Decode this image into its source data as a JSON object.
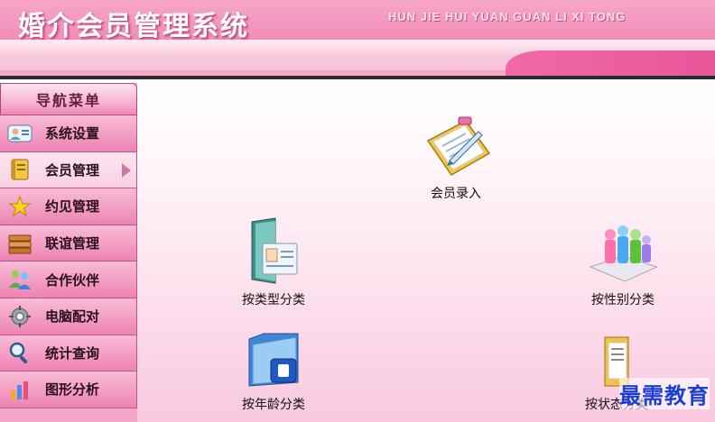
{
  "header": {
    "title": "婚介会员管理系统",
    "subtitle": "HUN JIE HUI YUAN GUAN LI XI TONG"
  },
  "sidebar": {
    "title": "导航菜单",
    "items": [
      {
        "label": "系统设置",
        "icon": "user-settings-icon"
      },
      {
        "label": "会员管理",
        "icon": "book-icon",
        "active": true
      },
      {
        "label": "约见管理",
        "icon": "star-icon"
      },
      {
        "label": "联谊管理",
        "icon": "stack-icon"
      },
      {
        "label": "合作伙伴",
        "icon": "people-icon"
      },
      {
        "label": "电脑配对",
        "icon": "gear-icon"
      },
      {
        "label": "统计查询",
        "icon": "magnifier-icon"
      },
      {
        "label": "图形分析",
        "icon": "bar-chart-icon"
      }
    ]
  },
  "main": {
    "tiles": [
      {
        "label": "会员录入",
        "icon": "clipboard-pen-icon"
      },
      {
        "label": "按类型分类",
        "icon": "contact-card-icon"
      },
      {
        "label": "按性别分类",
        "icon": "people-figures-icon"
      },
      {
        "label": "按年龄分类",
        "icon": "blue-folder-icon"
      },
      {
        "label": "按状态分类",
        "icon": "yellow-folder-icon"
      }
    ]
  },
  "watermark": "最需教育",
  "colors": {
    "header_pink": "#f38fba",
    "sidebar_pink": "#f39dc3",
    "active_item": "#fce6f0",
    "watermark_blue": "#1a3ed6"
  }
}
